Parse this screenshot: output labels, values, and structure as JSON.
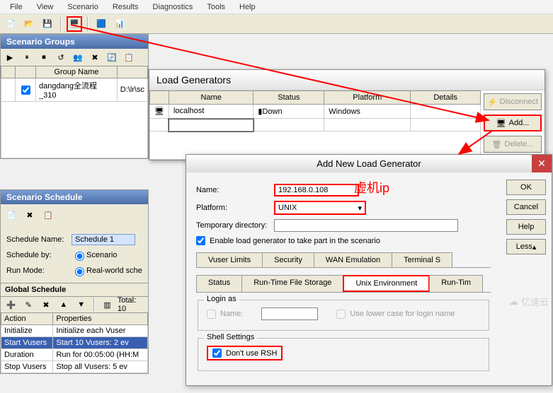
{
  "menu": {
    "items": [
      "File",
      "View",
      "Scenario",
      "Results",
      "Diagnostics",
      "Tools",
      "Help"
    ]
  },
  "scenario_groups": {
    "title": "Scenario Groups",
    "col_group": "Group Name",
    "row": {
      "name": "dangdang全流程_310",
      "path": "D:\\lr\\sc"
    }
  },
  "scenario_schedule": {
    "title": "Scenario Schedule",
    "name_label": "Schedule Name:",
    "name_value": "Schedule 1",
    "by_label": "Schedule by:",
    "by_value": "Scenario",
    "mode_label": "Run Mode:",
    "mode_value": "Real-world sche"
  },
  "global_schedule": {
    "title": "Global Schedule",
    "total": "Total: 10",
    "col_action": "Action",
    "col_props": "Properties",
    "rows": [
      {
        "action": "Initialize",
        "props": "Initialize each Vuser"
      },
      {
        "action": "Start  Vusers",
        "props": "Start 10 Vusers: 2 ev",
        "sel": true
      },
      {
        "action": "Duration",
        "props": "Run for 00:05:00 (HH:M"
      },
      {
        "action": "Stop Vusers",
        "props": "Stop all Vusers: 5 ev"
      }
    ]
  },
  "load_generators": {
    "title": "Load Generators",
    "cols": {
      "name": "Name",
      "status": "Status",
      "platform": "Platform",
      "details": "Details"
    },
    "row": {
      "name": "localhost",
      "status": "Down",
      "platform": "Windows"
    },
    "btn_disconnect": "Disconnect",
    "btn_add": "Add...",
    "btn_delete": "Delete..."
  },
  "add_generator": {
    "title": "Add New Load Generator",
    "name_label": "Name:",
    "name_value": "192.168.0.108",
    "platform_label": "Platform:",
    "platform_value": "UNIX",
    "tempdir_label": "Temporary directory:",
    "tempdir_value": "",
    "enable_label": "Enable load generator to take part in the scenario",
    "tabs_top": [
      "Vuser Limits",
      "Security",
      "WAN Emulation",
      "Terminal S"
    ],
    "tabs_bottom": [
      "Status",
      "Run-Time File Storage",
      "Unix Environment",
      "Run-Tim"
    ],
    "login_as": "Login as",
    "login_name": "Name:",
    "login_lower": "Use lower case for login name",
    "shell_settings": "Shell Settings",
    "dont_use_rsh": "Don't use RSH",
    "btn_ok": "OK",
    "btn_cancel": "Cancel",
    "btn_help": "Help",
    "btn_less": "Less"
  },
  "annotation": "虚机ip",
  "watermark": "亿速云"
}
